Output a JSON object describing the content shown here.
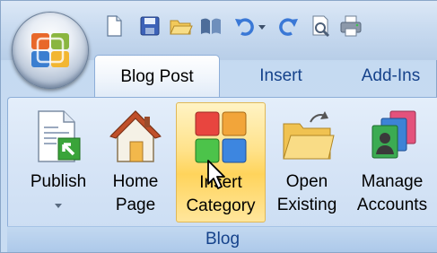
{
  "tabs": [
    {
      "label": "Blog Post",
      "active": true
    },
    {
      "label": "Insert",
      "active": false
    },
    {
      "label": "Add-Ins",
      "active": false
    }
  ],
  "ribbon": {
    "group_label": "Blog",
    "buttons": [
      {
        "line1": "Publish",
        "line2": "",
        "icon": "publish-icon",
        "has_dropdown": true
      },
      {
        "line1": "Home",
        "line2": "Page",
        "icon": "home-icon"
      },
      {
        "line1": "Insert",
        "line2": "Category",
        "icon": "category-icon",
        "hover": true
      },
      {
        "line1": "Open",
        "line2": "Existing",
        "icon": "open-folder-icon"
      },
      {
        "line1": "Manage",
        "line2": "Accounts",
        "icon": "accounts-icon"
      }
    ]
  },
  "quick_access": [
    "new-icon",
    "save-icon",
    "open-icon",
    "book-icon",
    "undo-icon",
    "redo-icon",
    "print-preview-icon",
    "print-icon"
  ],
  "colors": {
    "tab_text": "#15428b",
    "hover_bg": "#ffd45c"
  }
}
